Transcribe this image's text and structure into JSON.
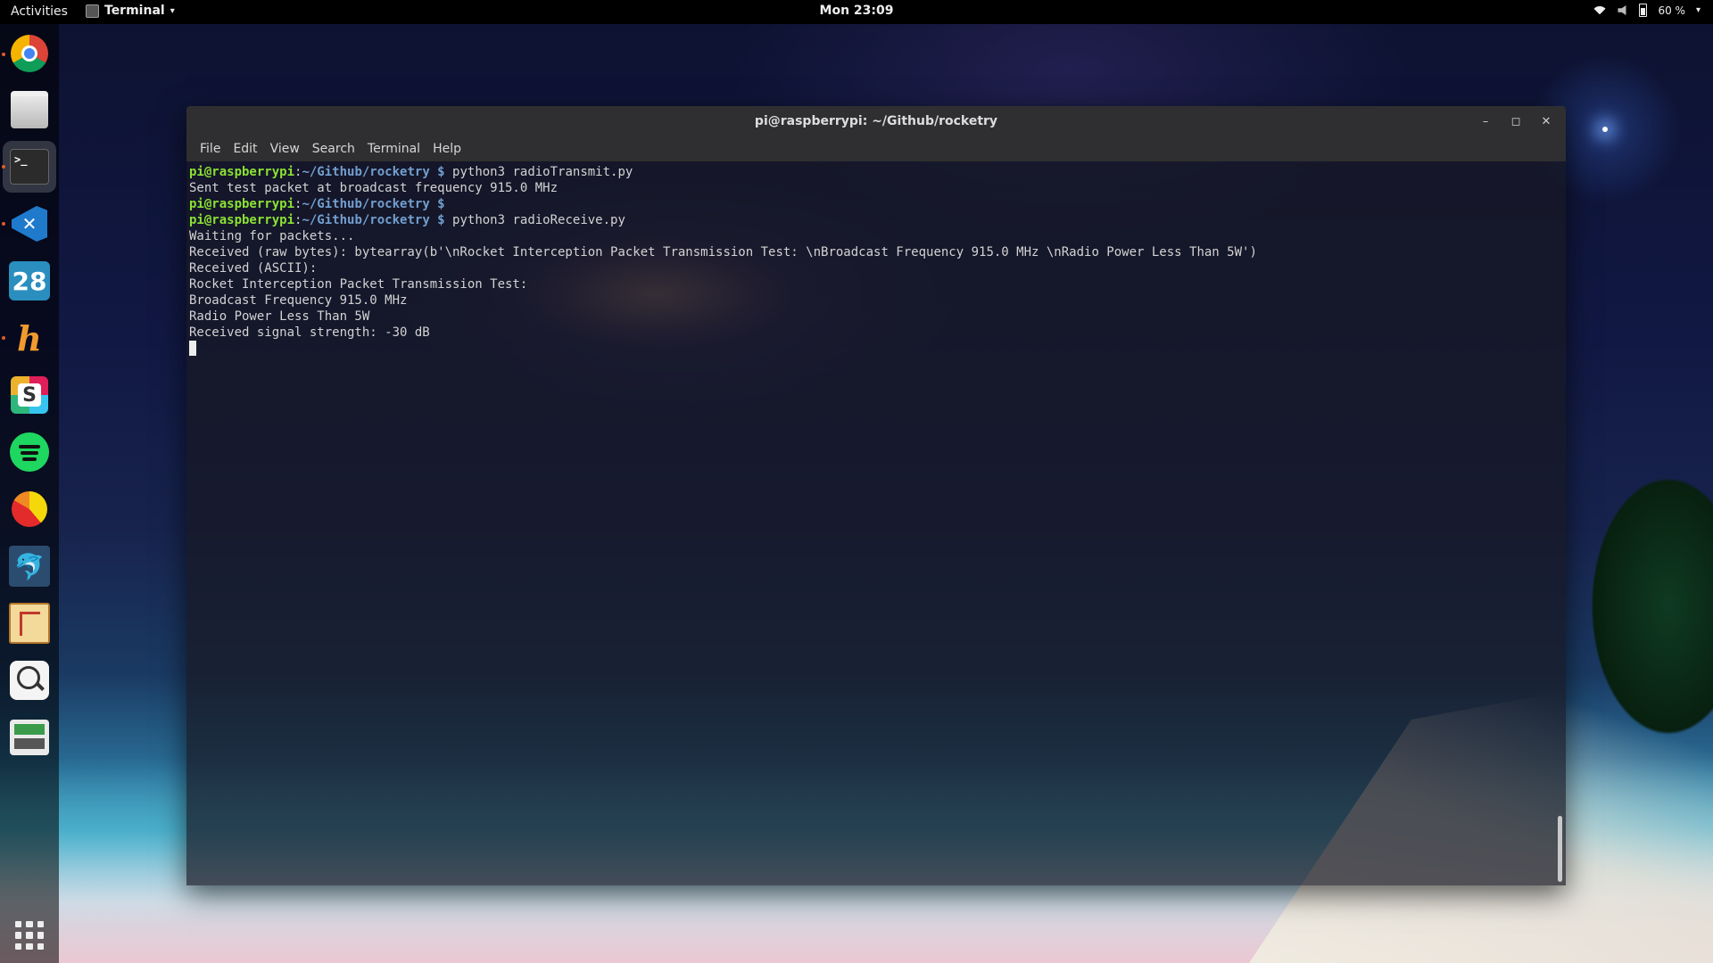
{
  "topbar": {
    "activities": "Activities",
    "app_name": "Terminal",
    "clock": "Mon 23:09",
    "battery": "60 %"
  },
  "dock": {
    "items": [
      {
        "name": "chrome-icon",
        "running": true
      },
      {
        "name": "files-icon",
        "running": false
      },
      {
        "name": "terminal-icon",
        "running": true,
        "active": true
      },
      {
        "name": "vscode-icon",
        "running": true
      },
      {
        "name": "calendar-icon",
        "label": "28",
        "running": false
      },
      {
        "name": "hypnotix-icon",
        "label": "h",
        "running": true
      },
      {
        "name": "slack-icon",
        "label": "S",
        "running": false
      },
      {
        "name": "spotify-icon",
        "running": false
      },
      {
        "name": "pie-app-icon",
        "running": false
      },
      {
        "name": "mysql-workbench-icon",
        "running": false
      },
      {
        "name": "schematic-icon",
        "running": false
      },
      {
        "name": "magnifier-icon",
        "running": false
      },
      {
        "name": "system-monitor-icon",
        "running": false
      }
    ],
    "show_apps_icon": "app-grid-icon"
  },
  "window": {
    "title": "pi@raspberrypi: ~/Github/rocketry",
    "menus": [
      "File",
      "Edit",
      "View",
      "Search",
      "Terminal",
      "Help"
    ]
  },
  "terminal": {
    "prompt_user": "pi@raspberrypi",
    "prompt_sep": ":",
    "prompt_path": "~/Github/rocketry",
    "prompt_dollar": " $",
    "lines": [
      {
        "type": "prompt",
        "command": " python3 radioTransmit.py"
      },
      {
        "type": "output",
        "text": "Sent test packet at broadcast frequency 915.0 MHz"
      },
      {
        "type": "prompt",
        "command": ""
      },
      {
        "type": "prompt",
        "command": " python3 radioReceive.py"
      },
      {
        "type": "output",
        "text": "Waiting for packets..."
      },
      {
        "type": "output",
        "text": "Received (raw bytes): bytearray(b'\\nRocket Interception Packet Transmission Test: \\nBroadcast Frequency 915.0 MHz \\nRadio Power Less Than 5W')"
      },
      {
        "type": "output",
        "text": "Received (ASCII):"
      },
      {
        "type": "output",
        "text": "Rocket Interception Packet Transmission Test:"
      },
      {
        "type": "output",
        "text": "Broadcast Frequency 915.0 MHz"
      },
      {
        "type": "output",
        "text": "Radio Power Less Than 5W"
      },
      {
        "type": "output",
        "text": "Received signal strength: -30 dB"
      }
    ]
  },
  "colors": {
    "prompt_user": "#8ae234",
    "prompt_path": "#729fcf",
    "terminal_text": "#d3d3d3",
    "titlebar": "#2f2f31"
  }
}
